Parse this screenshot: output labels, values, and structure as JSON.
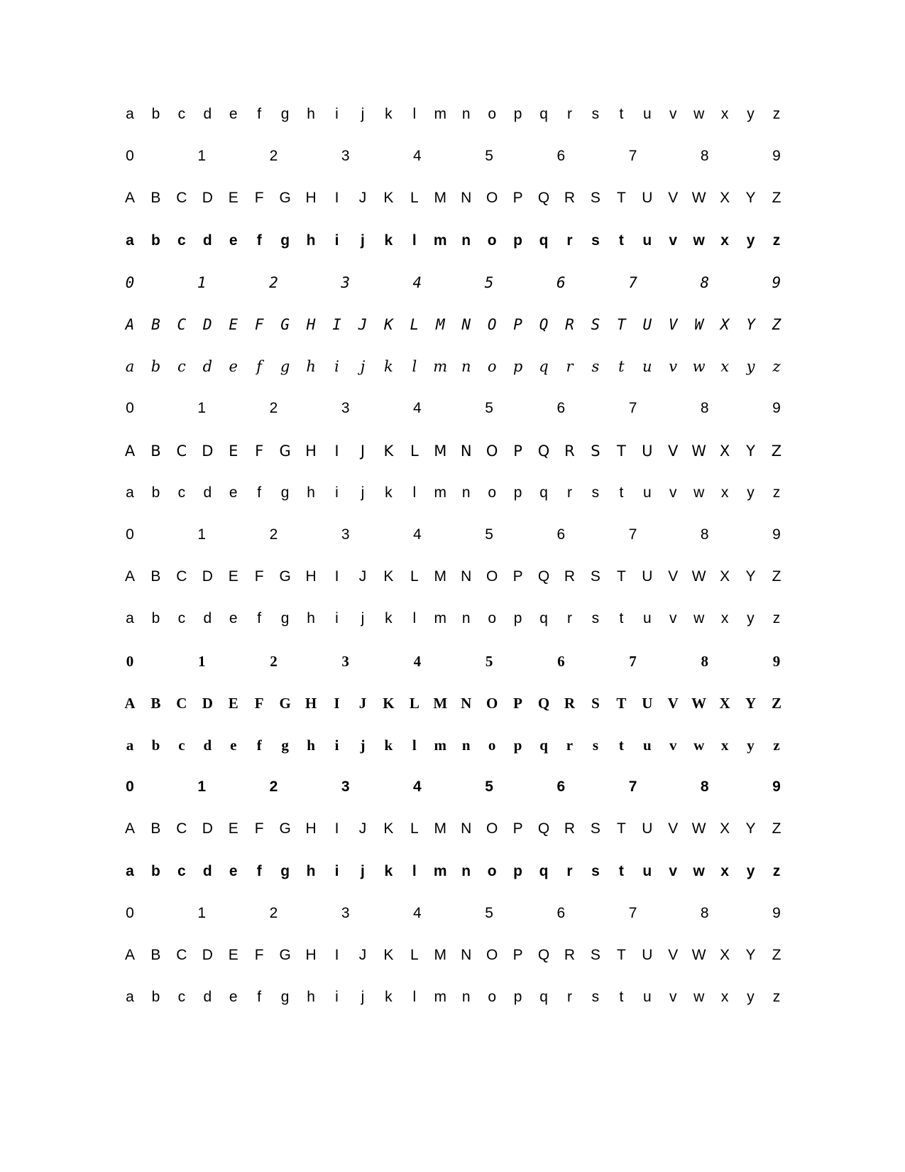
{
  "rows": [
    {
      "style": "sans",
      "chars": [
        "a",
        "b",
        "c",
        "d",
        "e",
        "f",
        "g",
        "h",
        "i",
        "j",
        "k",
        "l",
        "m",
        "n",
        "o",
        "p",
        "q",
        "r",
        "s",
        "t",
        "u",
        "v",
        "w",
        "x",
        "y",
        "z"
      ]
    },
    {
      "style": "sans",
      "chars": [
        "0",
        "1",
        "2",
        "3",
        "4",
        "5",
        "6",
        "7",
        "8",
        "9"
      ]
    },
    {
      "style": "sans",
      "chars": [
        "A",
        "B",
        "C",
        "D",
        "E",
        "F",
        "G",
        "H",
        "I",
        "J",
        "K",
        "L",
        "M",
        "N",
        "O",
        "P",
        "Q",
        "R",
        "S",
        "T",
        "U",
        "V",
        "W",
        "X",
        "Y",
        "Z"
      ]
    },
    {
      "style": "sans-bold",
      "chars": [
        "a",
        "b",
        "c",
        "d",
        "e",
        "f",
        "g",
        "h",
        "i",
        "j",
        "k",
        "l",
        "m",
        "n",
        "o",
        "p",
        "q",
        "r",
        "s",
        "t",
        "u",
        "v",
        "w",
        "x",
        "y",
        "z"
      ]
    },
    {
      "style": "mono-italic",
      "chars": [
        "0",
        "1",
        "2",
        "3",
        "4",
        "5",
        "6",
        "7",
        "8",
        "9"
      ]
    },
    {
      "style": "mono-italic",
      "chars": [
        "A",
        "B",
        "C",
        "D",
        "E",
        "F",
        "G",
        "H",
        "I",
        "J",
        "K",
        "L",
        "M",
        "N",
        "O",
        "P",
        "Q",
        "R",
        "S",
        "T",
        "U",
        "V",
        "W",
        "X",
        "Y",
        "Z"
      ]
    },
    {
      "style": "script",
      "chars": [
        "a",
        "b",
        "c",
        "d",
        "e",
        "f",
        "g",
        "h",
        "i",
        "j",
        "k",
        "l",
        "m",
        "n",
        "o",
        "p",
        "q",
        "r",
        "s",
        "t",
        "u",
        "v",
        "w",
        "x",
        "y",
        "z"
      ]
    },
    {
      "style": "sans",
      "chars": [
        "0",
        "1",
        "2",
        "3",
        "4",
        "5",
        "6",
        "7",
        "8",
        "9"
      ]
    },
    {
      "style": "dejavu",
      "chars": [
        "A",
        "B",
        "C",
        "D",
        "E",
        "F",
        "G",
        "H",
        "I",
        "J",
        "K",
        "L",
        "M",
        "N",
        "O",
        "P",
        "Q",
        "R",
        "S",
        "T",
        "U",
        "V",
        "W",
        "X",
        "Y",
        "Z"
      ]
    },
    {
      "style": "sans",
      "chars": [
        "a",
        "b",
        "c",
        "d",
        "e",
        "f",
        "g",
        "h",
        "i",
        "j",
        "k",
        "l",
        "m",
        "n",
        "o",
        "p",
        "q",
        "r",
        "s",
        "t",
        "u",
        "v",
        "w",
        "x",
        "y",
        "z"
      ]
    },
    {
      "style": "sans",
      "chars": [
        "0",
        "1",
        "2",
        "3",
        "4",
        "5",
        "6",
        "7",
        "8",
        "9"
      ]
    },
    {
      "style": "sans",
      "chars": [
        "A",
        "B",
        "C",
        "D",
        "E",
        "F",
        "G",
        "H",
        "I",
        "J",
        "K",
        "L",
        "M",
        "N",
        "O",
        "P",
        "Q",
        "R",
        "S",
        "T",
        "U",
        "V",
        "W",
        "X",
        "Y",
        "Z"
      ]
    },
    {
      "style": "sans",
      "chars": [
        "a",
        "b",
        "c",
        "d",
        "e",
        "f",
        "g",
        "h",
        "i",
        "j",
        "k",
        "l",
        "m",
        "n",
        "o",
        "p",
        "q",
        "r",
        "s",
        "t",
        "u",
        "v",
        "w",
        "x",
        "y",
        "z"
      ]
    },
    {
      "style": "serif-bold",
      "chars": [
        "0",
        "1",
        "2",
        "3",
        "4",
        "5",
        "6",
        "7",
        "8",
        "9"
      ]
    },
    {
      "style": "serif-bold",
      "chars": [
        "A",
        "B",
        "C",
        "D",
        "E",
        "F",
        "G",
        "H",
        "I",
        "J",
        "K",
        "L",
        "M",
        "N",
        "O",
        "P",
        "Q",
        "R",
        "S",
        "T",
        "U",
        "V",
        "W",
        "X",
        "Y",
        "Z"
      ]
    },
    {
      "style": "serif-bold",
      "chars": [
        "a",
        "b",
        "c",
        "d",
        "e",
        "f",
        "g",
        "h",
        "i",
        "j",
        "k",
        "l",
        "m",
        "n",
        "o",
        "p",
        "q",
        "r",
        "s",
        "t",
        "u",
        "v",
        "w",
        "x",
        "y",
        "z"
      ]
    },
    {
      "style": "sans-bold",
      "chars": [
        "0",
        "1",
        "2",
        "3",
        "4",
        "5",
        "6",
        "7",
        "8",
        "9"
      ]
    },
    {
      "style": "sans",
      "chars": [
        "A",
        "B",
        "C",
        "D",
        "E",
        "F",
        "G",
        "H",
        "I",
        "J",
        "K",
        "L",
        "M",
        "N",
        "O",
        "P",
        "Q",
        "R",
        "S",
        "T",
        "U",
        "V",
        "W",
        "X",
        "Y",
        "Z"
      ]
    },
    {
      "style": "sans-bold",
      "chars": [
        "a",
        "b",
        "c",
        "d",
        "e",
        "f",
        "g",
        "h",
        "i",
        "j",
        "k",
        "l",
        "m",
        "n",
        "o",
        "p",
        "q",
        "r",
        "s",
        "t",
        "u",
        "v",
        "w",
        "x",
        "y",
        "z"
      ]
    },
    {
      "style": "sans",
      "chars": [
        "0",
        "1",
        "2",
        "3",
        "4",
        "5",
        "6",
        "7",
        "8",
        "9"
      ]
    },
    {
      "style": "sans",
      "chars": [
        "A",
        "B",
        "C",
        "D",
        "E",
        "F",
        "G",
        "H",
        "I",
        "J",
        "K",
        "L",
        "M",
        "N",
        "O",
        "P",
        "Q",
        "R",
        "S",
        "T",
        "U",
        "V",
        "W",
        "X",
        "Y",
        "Z"
      ]
    },
    {
      "style": "sans",
      "chars": [
        "a",
        "b",
        "c",
        "d",
        "e",
        "f",
        "g",
        "h",
        "i",
        "j",
        "k",
        "l",
        "m",
        "n",
        "o",
        "p",
        "q",
        "r",
        "s",
        "t",
        "u",
        "v",
        "w",
        "x",
        "y",
        "z"
      ]
    }
  ]
}
